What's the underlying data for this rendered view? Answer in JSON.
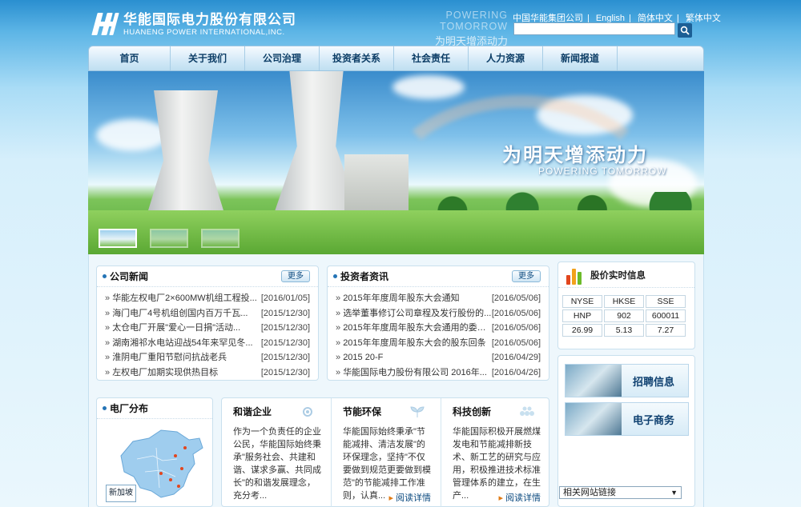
{
  "header": {
    "logo_cn": "华能国际电力股份有限公司",
    "logo_en": "HUANENG POWER INTERNATIONAL,INC.",
    "slogan_en": "POWERING TOMORROW",
    "slogan_cn": "为明天增添动力",
    "top_links": [
      "中国华能集团公司",
      "English",
      "简体中文",
      "繁体中文"
    ],
    "search_value": ""
  },
  "nav": [
    "首页",
    "关于我们",
    "公司治理",
    "投资者关系",
    "社会责任",
    "人力资源",
    "新闻报道"
  ],
  "banner": {
    "slogan_cn": "为明天增添动力",
    "slogan_en": "POWERING TOMORROW"
  },
  "company_news": {
    "title": "公司新闻",
    "more": "更多",
    "items": [
      {
        "title": "华能左权电厂2×600MW机组工程投...",
        "date": "[2016/01/05]"
      },
      {
        "title": "海门电厂4号机组创国内百万千瓦...",
        "date": "[2015/12/30]"
      },
      {
        "title": "太仓电厂开展\"爱心一日捐\"活动...",
        "date": "[2015/12/30]"
      },
      {
        "title": "湖南湘祁水电站迎战54年来罕见冬...",
        "date": "[2015/12/30]"
      },
      {
        "title": "淮阴电厂重阳节慰问抗战老兵",
        "date": "[2015/12/30]"
      },
      {
        "title": "左权电厂加期实现供热目标",
        "date": "[2015/12/30]"
      }
    ]
  },
  "investor_news": {
    "title": "投资者资讯",
    "more": "更多",
    "items": [
      {
        "title": "2015年年度周年股东大会通知",
        "date": "[2016/05/06]"
      },
      {
        "title": "选举董事修订公司章程及发行股份的...",
        "date": "[2016/05/06]"
      },
      {
        "title": "2015年年度周年股东大会通用的委托...",
        "date": "[2016/05/06]"
      },
      {
        "title": "2015年年度周年股东大会的股东回条",
        "date": "[2016/05/06]"
      },
      {
        "title": "2015 20-F",
        "date": "[2016/04/29]"
      },
      {
        "title": "华能国际电力股份有限公司 2016年...",
        "date": "[2016/04/26]"
      }
    ]
  },
  "stock": {
    "title": "股价实时信息",
    "headers": [
      "NYSE",
      "HKSE",
      "SSE"
    ],
    "codes": [
      "HNP",
      "902",
      "600011"
    ],
    "prices": [
      "26.99",
      "5.13",
      "7.27"
    ],
    "icon_colors": [
      "#e2461e",
      "#f2a21b",
      "#6cbb2a"
    ]
  },
  "promos": [
    {
      "label": "招聘信息"
    },
    {
      "label": "电子商务"
    }
  ],
  "related_links": {
    "selected": "相关网站链接"
  },
  "plant_map": {
    "title": "电厂分布",
    "badge": "新加坡"
  },
  "features": [
    {
      "title": "和谐企业",
      "body": "作为一个负责任的企业公民，华能国际始终秉承\"服务社会、共建和谐、谋求多赢、共同成长\"的和谐发展理念，充分考...",
      "link": "阅读详情",
      "icon": "gear-icon"
    },
    {
      "title": "节能环保",
      "body": "华能国际始终秉承\"节能减排、清洁发展\"的环保理念，坚持\"不仅要做到规范更要做到模范\"的节能减排工作准则，认真...",
      "link": "阅读详情",
      "icon": "leaf-icon"
    },
    {
      "title": "科技创新",
      "body": "华能国际积极开展燃煤发电和节能减排新技术、新工艺的研究与应用，积极推进技术标准管理体系的建立，在生产...",
      "link": "阅读详情",
      "icon": "drops-icon"
    }
  ]
}
